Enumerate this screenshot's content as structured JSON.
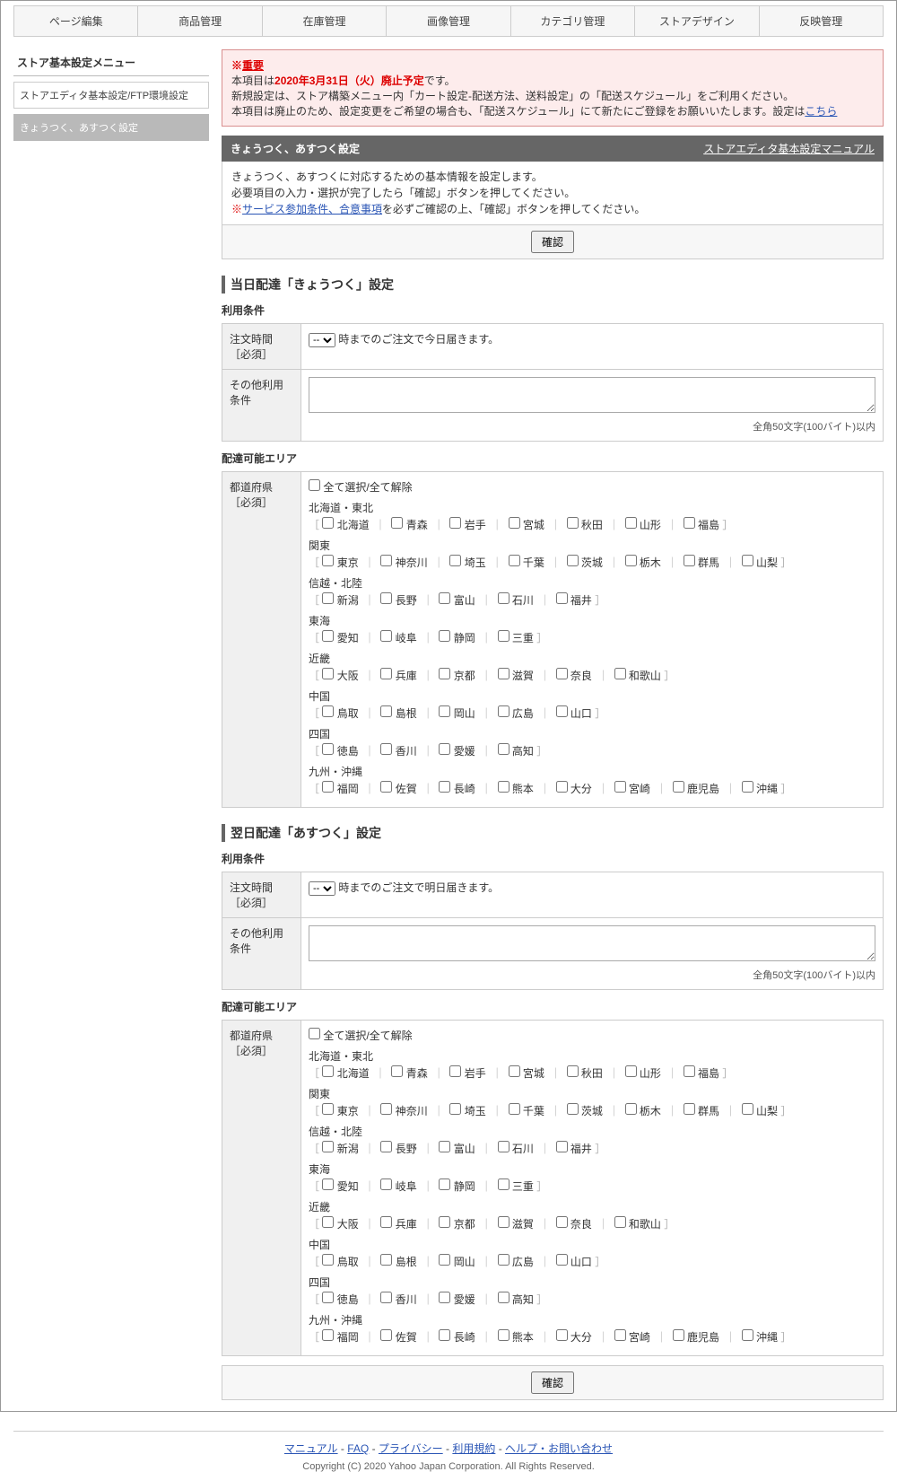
{
  "topnav": [
    "ページ編集",
    "商品管理",
    "在庫管理",
    "画像管理",
    "カテゴリ管理",
    "ストアデザイン",
    "反映管理"
  ],
  "sidebar": {
    "title": "ストア基本設定メニュー",
    "items": [
      {
        "label": "ストアエディタ基本設定/FTP環境設定"
      },
      {
        "label": "きょうつく、あすつく設定"
      }
    ]
  },
  "alert": {
    "important_prefix": "※",
    "important": "重要",
    "line1_before": "本項目は",
    "line1_strong": "2020年3月31日（火）廃止予定",
    "line1_after": "です。",
    "line2": "新規設定は、ストア構築メニュー内「カート設定-配送方法、送料設定」の「配送スケジュール」をご利用ください。",
    "line3_before": "本項目は廃止のため、設定変更をご希望の場合も、「配送スケジュール」にて新たにご登録をお願いいたします。設定は",
    "line3_link": "こちら"
  },
  "page": {
    "title": "きょうつく、あすつく設定",
    "manual_link": "ストアエディタ基本設定マニュアル",
    "desc1": "きょうつく、あすつくに対応するための基本情報を設定します。",
    "desc2": "必要項目の入力・選択が完了したら「確認」ボタンを押してください。",
    "desc3_prefix": "※",
    "desc3_link": "サービス参加条件、合意事項",
    "desc3_after": "を必ずご確認の上、「確認」ボタンを押してください。",
    "confirm_btn": "確認"
  },
  "section1": {
    "heading": "当日配達「きょうつく」設定",
    "sub1": "利用条件",
    "order_time_label": "注文時間［必須］",
    "order_time_select": "--",
    "order_time_text": "時までのご注文で今日届きます。",
    "other_label": "その他利用条件",
    "other_note": "全角50文字(100バイト)以内",
    "sub2": "配達可能エリア",
    "pref_label": "都道府県［必須］"
  },
  "section2": {
    "heading": "翌日配達「あすつく」設定",
    "sub1": "利用条件",
    "order_time_label": "注文時間［必須］",
    "order_time_select": "--",
    "order_time_text": "時までのご注文で明日届きます。",
    "other_label": "その他利用条件",
    "other_note": "全角50文字(100バイト)以内",
    "sub2": "配達可能エリア",
    "pref_label": "都道府県［必須］"
  },
  "prefs": {
    "select_all": "全て選択/全て解除",
    "regions": [
      {
        "name": "北海道・東北",
        "list": [
          "北海道",
          "青森",
          "岩手",
          "宮城",
          "秋田",
          "山形",
          "福島"
        ]
      },
      {
        "name": "関東",
        "list": [
          "東京",
          "神奈川",
          "埼玉",
          "千葉",
          "茨城",
          "栃木",
          "群馬",
          "山梨"
        ]
      },
      {
        "name": "信越・北陸",
        "list": [
          "新潟",
          "長野",
          "富山",
          "石川",
          "福井"
        ]
      },
      {
        "name": "東海",
        "list": [
          "愛知",
          "岐阜",
          "静岡",
          "三重"
        ]
      },
      {
        "name": "近畿",
        "list": [
          "大阪",
          "兵庫",
          "京都",
          "滋賀",
          "奈良",
          "和歌山"
        ]
      },
      {
        "name": "中国",
        "list": [
          "鳥取",
          "島根",
          "岡山",
          "広島",
          "山口"
        ]
      },
      {
        "name": "四国",
        "list": [
          "徳島",
          "香川",
          "愛媛",
          "高知"
        ]
      },
      {
        "name": "九州・沖縄",
        "list": [
          "福岡",
          "佐賀",
          "長崎",
          "熊本",
          "大分",
          "宮崎",
          "鹿児島",
          "沖縄"
        ]
      }
    ]
  },
  "footer": {
    "links": [
      "マニュアル",
      "FAQ",
      "プライバシー",
      "利用規約",
      "ヘルプ・お問い合わせ"
    ],
    "copy": "Copyright (C) 2020 Yahoo Japan Corporation. All Rights Reserved."
  }
}
